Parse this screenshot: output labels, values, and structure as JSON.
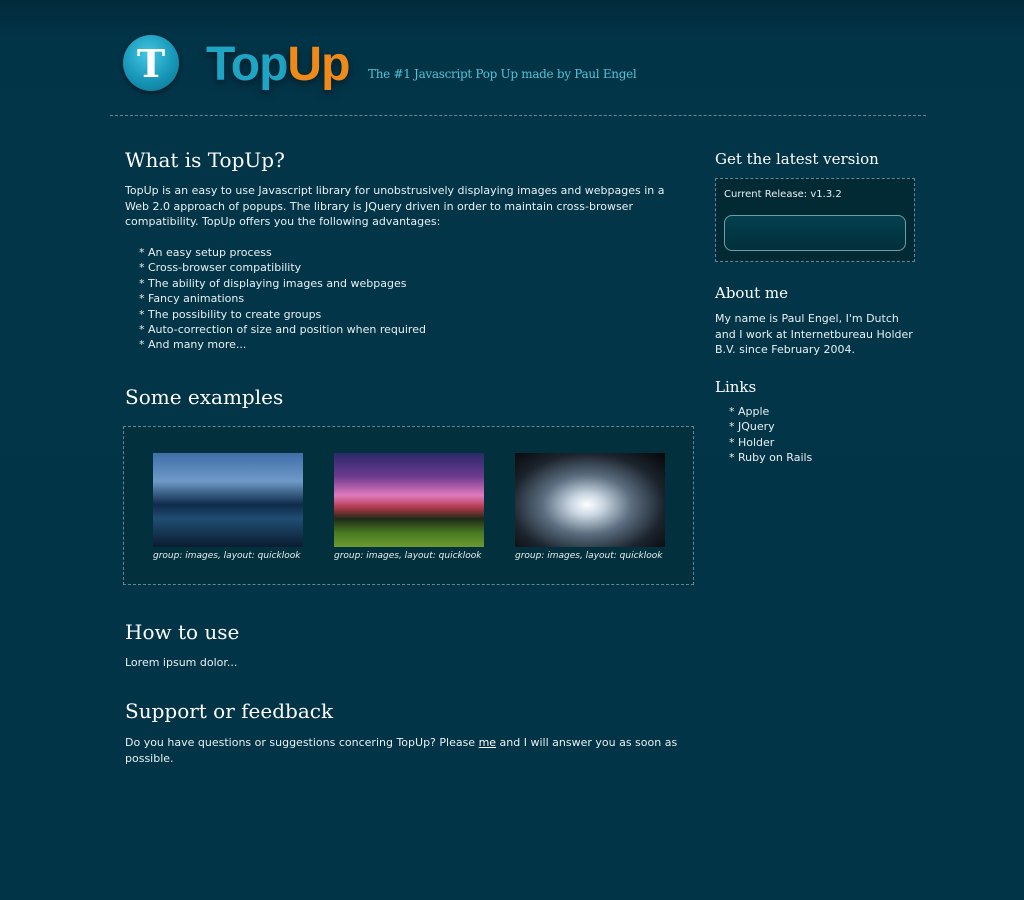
{
  "header": {
    "logo_letter": "T",
    "logo_word_part1": "Top",
    "logo_word_part2": "Up",
    "tagline": "The #1 Javascript Pop Up made by Paul Engel",
    "colors": {
      "logo_blue": "#1fa4c4",
      "logo_orange": "#ef8a1a",
      "tagline": "#56c0d4",
      "background": "#023448"
    }
  },
  "main": {
    "what": {
      "title": "What is TopUp?",
      "intro": "TopUp is an easy to use Javascript library for unobstrusively displaying images and webpages in a Web 2.0 approach of popups. The library is JQuery driven in order to maintain cross-browser compatibility. TopUp offers you the following advantages:",
      "advantages": [
        "* An easy setup process",
        "* Cross-browser compatibility",
        "* The ability of displaying images and webpages",
        "* Fancy animations",
        "* The possibility to create groups",
        "* Auto-correction of size and position when required",
        "* And many more..."
      ]
    },
    "examples": {
      "title": "Some examples",
      "items": [
        {
          "caption": "group: images, layout: quicklook",
          "image": "city-skyline-night"
        },
        {
          "caption": "group: images, layout: quicklook",
          "image": "purple-sunset-field"
        },
        {
          "caption": "group: images, layout: quicklook",
          "image": "sunlight-over-sea"
        }
      ]
    },
    "how": {
      "title": "How to use",
      "text": "Lorem ipsum dolor..."
    },
    "support": {
      "title": "Support or feedback",
      "text_before": "Do you have questions or suggestions concering TopUp? Please ",
      "link_text": "me",
      "text_after": " and I will answer you as soon as possible."
    }
  },
  "sidebar": {
    "latest": {
      "title": "Get the latest version",
      "release": "Current Release: v1.3.2"
    },
    "about": {
      "title": "About me",
      "text": "My name is Paul Engel, I'm Dutch and I work at Internetbureau Holder B.V. since February 2004."
    },
    "links": {
      "title": "Links",
      "items": [
        "* Apple",
        "* JQuery",
        "* Holder",
        "* Ruby on Rails"
      ]
    }
  }
}
